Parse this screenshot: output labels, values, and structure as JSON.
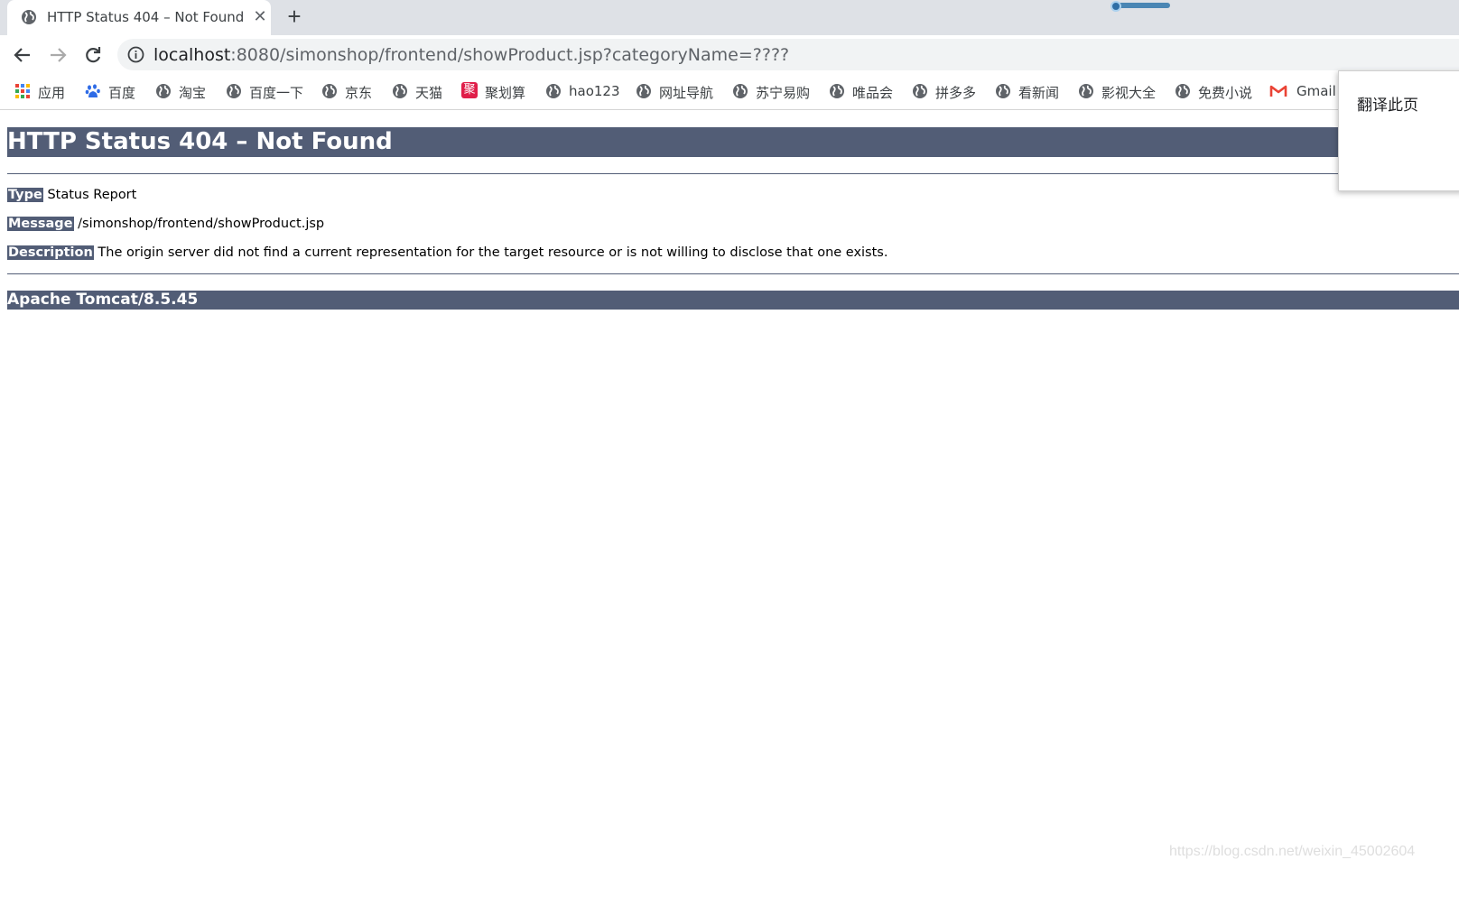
{
  "tab": {
    "title": "HTTP Status 404 – Not Found",
    "close_glyph": "✕",
    "new_tab_glyph": "+"
  },
  "address_bar": {
    "url_host": "localhost",
    "url_rest": ":8080/simonshop/frontend/showProduct.jsp?categoryName=????"
  },
  "bookmarks": [
    {
      "label": "应用",
      "icon": "apps-grid-icon"
    },
    {
      "label": "百度",
      "icon": "baidu-paw-icon"
    },
    {
      "label": "淘宝",
      "icon": "globe-icon"
    },
    {
      "label": "百度一下",
      "icon": "globe-icon"
    },
    {
      "label": "京东",
      "icon": "globe-icon"
    },
    {
      "label": "天猫",
      "icon": "globe-icon"
    },
    {
      "label": "聚划算",
      "icon": "juhuasuan-icon",
      "icon_text": "聚"
    },
    {
      "label": "hao123",
      "icon": "globe-icon"
    },
    {
      "label": "网址导航",
      "icon": "globe-icon"
    },
    {
      "label": "苏宁易购",
      "icon": "globe-icon"
    },
    {
      "label": "唯品会",
      "icon": "globe-icon"
    },
    {
      "label": "拼多多",
      "icon": "globe-icon"
    },
    {
      "label": "看新闻",
      "icon": "globe-icon"
    },
    {
      "label": "影视大全",
      "icon": "globe-icon"
    },
    {
      "label": "免费小说",
      "icon": "globe-icon"
    },
    {
      "label": "Gmail",
      "icon": "gmail-icon"
    }
  ],
  "translate_popup": {
    "text": "翻译此页"
  },
  "page": {
    "heading": "HTTP Status 404 – Not Found",
    "type_label": "Type",
    "type_value": "Status Report",
    "message_label": "Message",
    "message_value": "/simonshop/frontend/showProduct.jsp",
    "description_label": "Description",
    "description_value": "The origin server did not find a current representation for the target resource or is not willing to disclose that one exists.",
    "footer": "Apache Tomcat/8.5.45"
  },
  "watermark": "https://blog.csdn.net/weixin_45002604",
  "colors": {
    "tomcat_header": "#525d76",
    "tabstrip": "#dee1e6",
    "omnibox": "#f1f3f4"
  }
}
